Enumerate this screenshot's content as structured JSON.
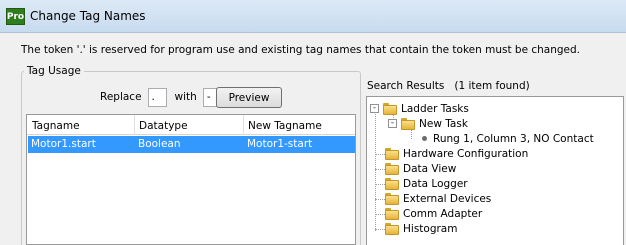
{
  "window": {
    "app_badge": "Pro",
    "title": "Change Tag Names"
  },
  "info_message": "The token '.' is reserved for program use and existing tag names that contain the token must be changed.",
  "tag_usage": {
    "group_label": "Tag Usage",
    "replace_label": "Replace",
    "replace_value": ".",
    "with_label": "with",
    "with_value": "-",
    "preview_label": "Preview",
    "columns": [
      "Tagname",
      "Datatype",
      "New Tagname"
    ],
    "rows": [
      {
        "tagname": "Motor1.start",
        "datatype": "Boolean",
        "new_tagname": "Motor1-start",
        "selected": true
      }
    ]
  },
  "search_results": {
    "header": "Search Results",
    "count_text": "(1 item found)",
    "tree": {
      "ladder_tasks": "Ladder Tasks",
      "new_task": "New Task",
      "rung_item": "Rung 1, Column 3, NO Contact",
      "hardware_configuration": "Hardware Configuration",
      "data_view": "Data View",
      "data_logger": "Data Logger",
      "external_devices": "External Devices",
      "comm_adapter": "Comm Adapter",
      "histogram": "Histogram"
    }
  },
  "colors": {
    "selection": "#3399ff",
    "app_badge_bg": "#2f7d1e",
    "folder": "#e5b43a"
  },
  "icons": {
    "app": "app-logo-icon",
    "folder": "folder-icon",
    "expander": "collapse-icon",
    "item": "bullet-icon"
  }
}
